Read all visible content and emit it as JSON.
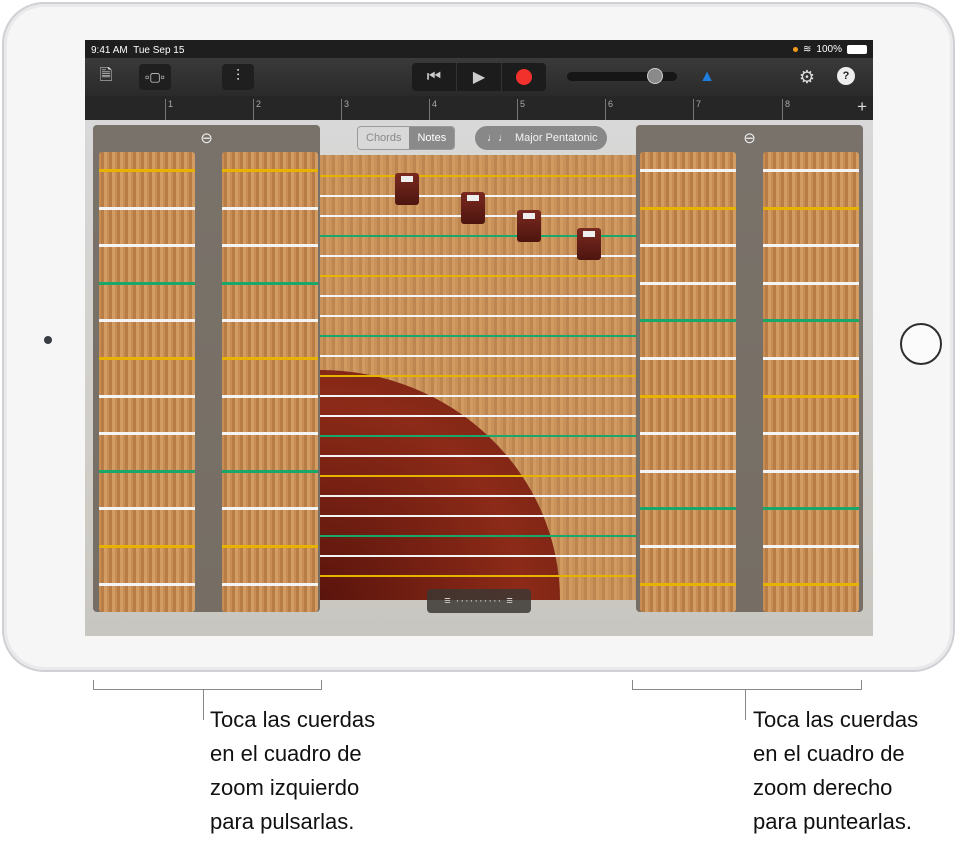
{
  "status": {
    "time": "9:41 AM",
    "date": "Tue Sep 15",
    "battery": "100%"
  },
  "toolbar": {
    "icons": [
      "document-icon",
      "tracks-view-icon",
      "mixer-icon",
      "rewind-icon",
      "play-icon",
      "record-icon",
      "metronome-icon",
      "settings-icon",
      "help-icon"
    ],
    "help": "?",
    "volume": 0.8
  },
  "ruler": {
    "bars": [
      "1",
      "2",
      "3",
      "4",
      "5",
      "6",
      "7",
      "8"
    ],
    "add": "+"
  },
  "controls": {
    "chords": "Chords",
    "notes": "Notes",
    "selected": "Notes",
    "scale": "Major Pentatonic",
    "zoom_icon": "zoom-out-icon",
    "handle": "≡ ·········· ≡"
  },
  "colors": {
    "yellow": "#e6b400",
    "white": "#f4f4f4",
    "green": "#1aa86a",
    "record": "#f2312c",
    "metronome": "#1f7fe0"
  },
  "captions": {
    "left": [
      "Toca las cuerdas",
      "en el cuadro de",
      "zoom izquierdo",
      "para pulsarlas."
    ],
    "right": [
      "Toca las cuerdas",
      "en el cuadro de",
      "zoom derecho",
      "para puntearlas."
    ]
  }
}
